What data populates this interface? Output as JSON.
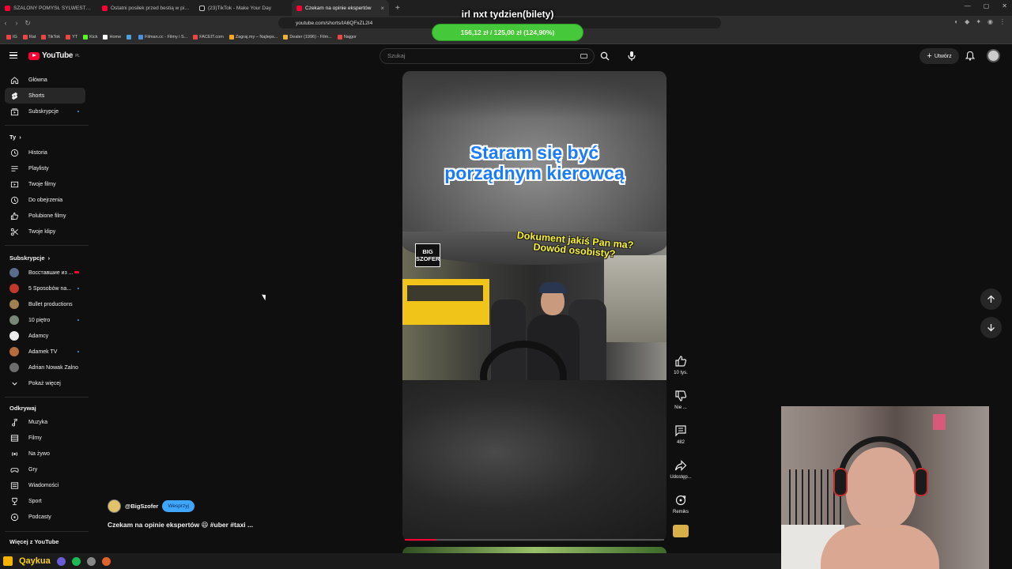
{
  "browser": {
    "tabs": [
      {
        "label": "SZALONY POMYSŁ SYLWESTRA! Czy",
        "active": false
      },
      {
        "label": "Ostatni posiłek przed bestią w pizzeri",
        "active": false
      },
      {
        "label": "(23)TikTok - Make Your Day",
        "active": false
      },
      {
        "label": "Czekam na opinie ekspertów",
        "active": true
      }
    ],
    "new_tab": "+",
    "close_tab": "×",
    "url": "youtube.com/shorts/IA6QFxZL2I4",
    "bookmarks": [
      "IG",
      "Rat",
      "TikTok",
      "YT",
      "Kick",
      "Home",
      "",
      "Filman.cc - Filmy i S...",
      "FACEIT.com",
      "Zagraj.my – Najleps...",
      "Dealer (1996) - Film...",
      "Najgor"
    ]
  },
  "donation": {
    "title": "irl nxt tydzien(bilety)",
    "progress_text": "156,12 zł / 125,00 zł (124,90%)",
    "percent": 124.9
  },
  "header": {
    "logo_text": "YouTube",
    "logo_region": "PL",
    "search_placeholder": "Szukaj",
    "create_label": "Utwórz"
  },
  "sidebar": {
    "main": [
      {
        "label": "Główna",
        "icon": "home-icon"
      },
      {
        "label": "Shorts",
        "icon": "shorts-icon",
        "active": true
      },
      {
        "label": "Subskrypcje",
        "icon": "subscriptions-icon"
      }
    ],
    "you_heading": "Ty",
    "you": [
      {
        "label": "Historia",
        "icon": "history-icon"
      },
      {
        "label": "Playlisty",
        "icon": "playlist-icon"
      },
      {
        "label": "Twoje filmy",
        "icon": "your-videos-icon"
      },
      {
        "label": "Do obejrzenia",
        "icon": "watch-later-icon"
      },
      {
        "label": "Polubione filmy",
        "icon": "liked-icon"
      },
      {
        "label": "Twoje klipy",
        "icon": "clips-icon"
      }
    ],
    "subs_heading": "Subskrypcje",
    "subs": [
      {
        "label": "Восставшие из ...",
        "color": "#5a6b8c",
        "live": true
      },
      {
        "label": "5 Sposobów na...",
        "color": "#c0392b"
      },
      {
        "label": "Bullet productions",
        "color": "#a08050"
      },
      {
        "label": "10 piętro",
        "color": "#778877"
      },
      {
        "label": "Adamcy",
        "color": "#eeeeee"
      },
      {
        "label": "Adamek TV",
        "color": "#b86b3a"
      },
      {
        "label": "Adrian Nowak Zalno",
        "color": "#6d6d6d"
      }
    ],
    "show_more": "Pokaż więcej",
    "explore_heading": "Odkrywaj",
    "explore": [
      {
        "label": "Muzyka",
        "icon": "music-icon"
      },
      {
        "label": "Filmy",
        "icon": "movies-icon"
      },
      {
        "label": "Na żywo",
        "icon": "live-icon"
      },
      {
        "label": "Gry",
        "icon": "gaming-icon"
      },
      {
        "label": "Wiadomości",
        "icon": "news-icon"
      },
      {
        "label": "Sport",
        "icon": "sport-icon"
      },
      {
        "label": "Podcasty",
        "icon": "podcast-icon"
      }
    ],
    "more_heading": "Więcej z YouTube"
  },
  "video": {
    "caption_main_line1": "Staram się być",
    "caption_main_line2": "porządnym kierowcą",
    "caption_sub_line1": "Dokument jakiś Pan ma?",
    "caption_sub_line2": "Dowód osobisty?",
    "logo_line1": "BIG",
    "logo_line2": "SZOFER",
    "progress": 0.12
  },
  "actions": {
    "likes": "10 tys.",
    "dislike": "Nie ...",
    "comments": "482",
    "share": "Udostęp...",
    "remix": "Remiks"
  },
  "channel": {
    "handle": "@BigSzofer",
    "support_label": "Wesprzyj",
    "title": "Czekam na opinie ekspertów 😆 #uber #taxi ..."
  },
  "taskbar": {
    "name": "Qaykua"
  }
}
